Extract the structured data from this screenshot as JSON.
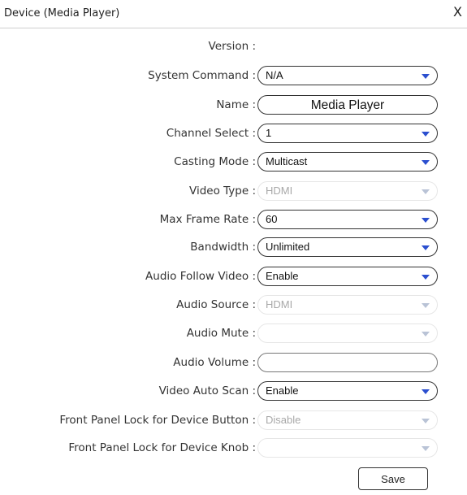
{
  "dialog": {
    "title": "Device (Media Player)",
    "close_label": "X",
    "save_label": "Save"
  },
  "fields": {
    "version": {
      "label": "Version :",
      "value": ""
    },
    "system_command": {
      "label": "System Command :",
      "value": "N/A"
    },
    "name": {
      "label": "Name :",
      "value": "Media Player"
    },
    "channel_select": {
      "label": "Channel Select :",
      "value": "1"
    },
    "casting_mode": {
      "label": "Casting Mode :",
      "value": "Multicast"
    },
    "video_type": {
      "label": "Video Type :",
      "value": "HDMI"
    },
    "max_frame_rate": {
      "label": "Max Frame Rate :",
      "value": "60"
    },
    "bandwidth": {
      "label": "Bandwidth :",
      "value": "Unlimited"
    },
    "audio_follow_video": {
      "label": "Audio Follow Video :",
      "value": "Enable"
    },
    "audio_source": {
      "label": "Audio Source :",
      "value": "HDMI"
    },
    "audio_mute": {
      "label": "Audio Mute :",
      "value": ""
    },
    "audio_volume": {
      "label": "Audio Volume :",
      "value": ""
    },
    "video_auto_scan": {
      "label": "Video Auto Scan :",
      "value": "Enable"
    },
    "front_panel_lock_button": {
      "label": "Front Panel Lock for Device Button :",
      "value": "Disable"
    },
    "front_panel_lock_knob": {
      "label": "Front Panel Lock for Device Knob :",
      "value": ""
    }
  },
  "colors": {
    "dropdown_arrow": "#2b4fcf",
    "disabled_text": "#a8a8a8"
  }
}
